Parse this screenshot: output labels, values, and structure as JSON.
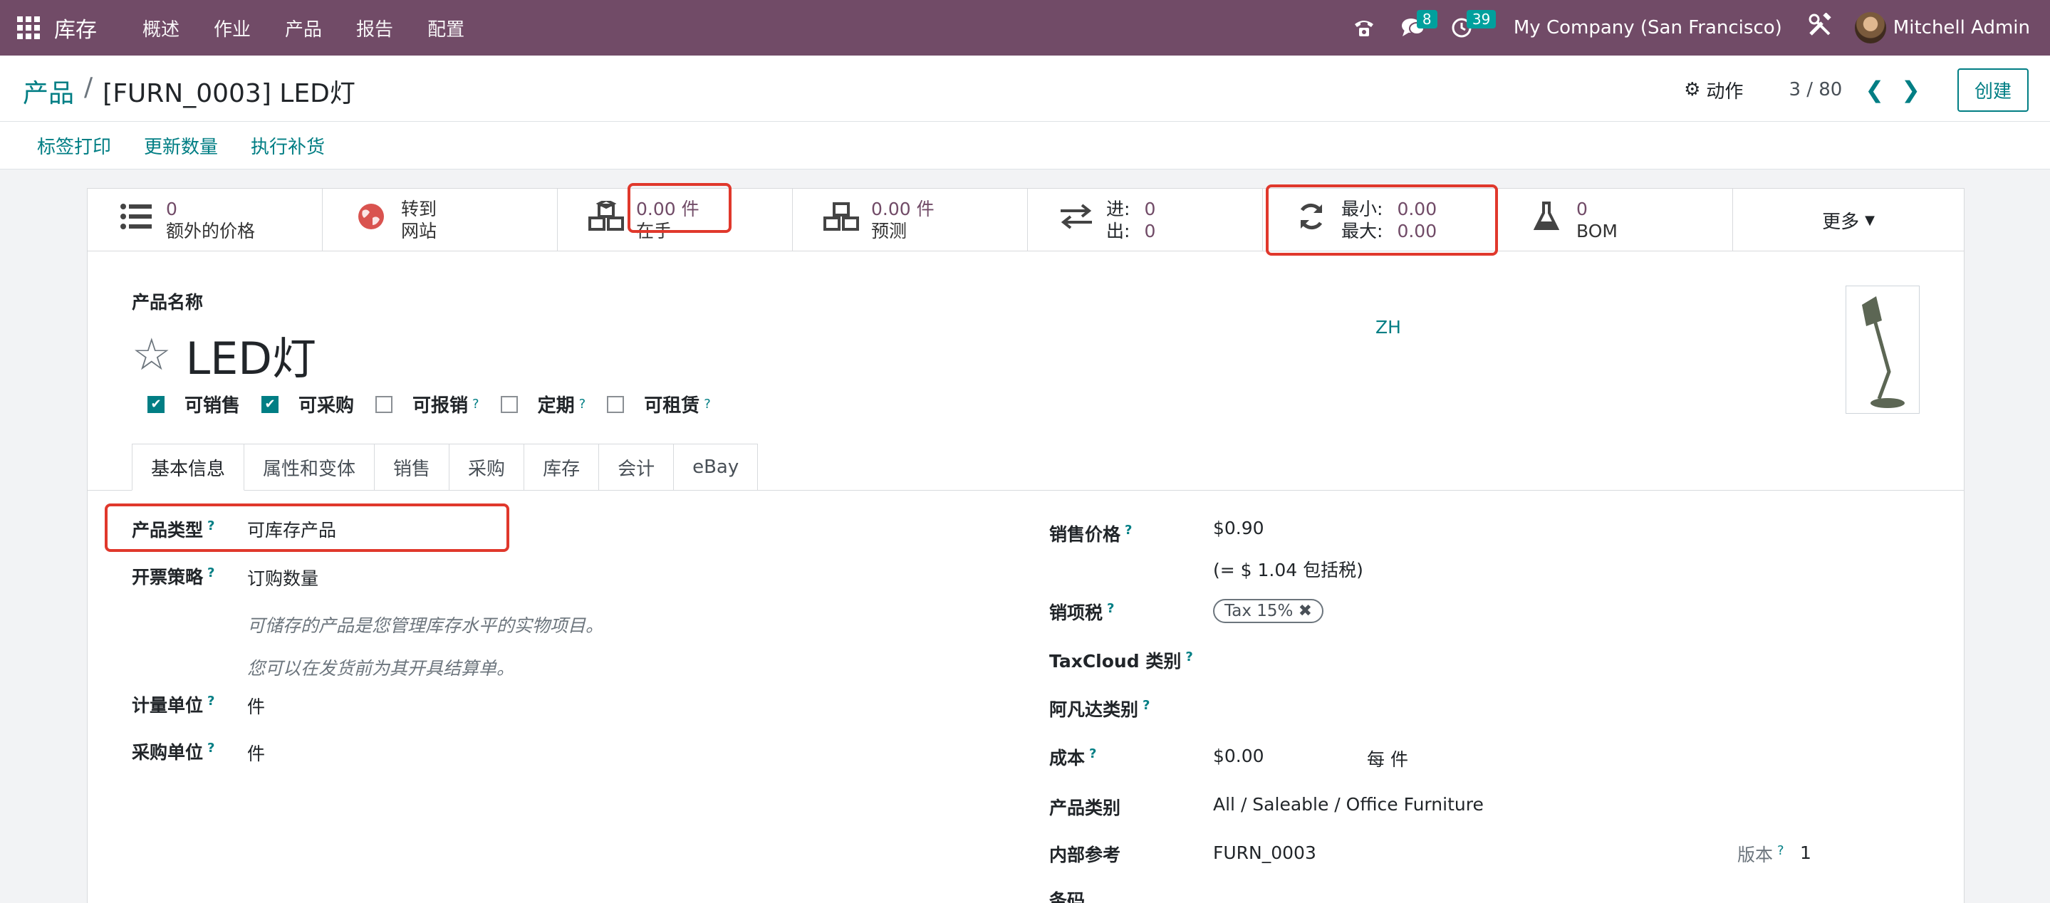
{
  "navbar": {
    "app_name": "库存",
    "menu": [
      "概述",
      "作业",
      "产品",
      "报告",
      "配置"
    ],
    "messages_count": "8",
    "activities_count": "39",
    "company": "My Company (San Francisco)",
    "user": "Mitchell Admin",
    "icons": {
      "apps": "apps-grid-icon",
      "phone": "phone-icon",
      "chat": "chat-icon",
      "clock": "clock-icon",
      "tools": "tools-icon"
    }
  },
  "control": {
    "breadcrumb_parent": "产品",
    "breadcrumb_sep": "/",
    "breadcrumb_current": "[FURN_0003] LED灯",
    "action_label": "动作",
    "pager": "3 / 80",
    "create_label": "创建",
    "buttons": [
      "标签打印",
      "更新数量",
      "执行补货"
    ]
  },
  "stats": {
    "extra_prices": {
      "value": "0",
      "label": "额外的价格"
    },
    "website": {
      "value": "转到",
      "label": "网站"
    },
    "on_hand": {
      "value": "0.00 件",
      "label": "在手"
    },
    "forecast": {
      "value": "0.00 件",
      "label": "预测"
    },
    "inout": {
      "in_label": "进:",
      "in_value": "0",
      "out_label": "出:",
      "out_value": "0"
    },
    "minmax": {
      "min_label": "最小:",
      "min_value": "0.00",
      "max_label": "最大:",
      "max_value": "0.00"
    },
    "bom": {
      "value": "0",
      "label": "BOM"
    },
    "more_label": "更多"
  },
  "product": {
    "name_label": "产品名称",
    "name": "LED灯",
    "lang": "ZH",
    "checks": [
      {
        "label": "可销售",
        "checked": true,
        "help": false
      },
      {
        "label": "可采购",
        "checked": true,
        "help": false
      },
      {
        "label": "可报销",
        "checked": false,
        "help": true
      },
      {
        "label": "定期",
        "checked": false,
        "help": true
      },
      {
        "label": "可租赁",
        "checked": false,
        "help": true
      }
    ]
  },
  "tabs": [
    "基本信息",
    "属性和变体",
    "销售",
    "采购",
    "库存",
    "会计",
    "eBay"
  ],
  "left_fields": {
    "type_label": "产品类型",
    "type_value": "可库存产品",
    "invoice_label": "开票策略",
    "invoice_value": "订购数量",
    "hint1": "可储存的产品是您管理库存水平的实物项目。",
    "hint2": "您可以在发货前为其开具结算单。",
    "uom_label": "计量单位",
    "uom_value": "件",
    "purchase_uom_label": "采购单位",
    "purchase_uom_value": "件"
  },
  "right_fields": {
    "price_label": "销售价格",
    "price_value": "$0.90",
    "price_incl": "(= $ 1.04 包括税)",
    "tax_label": "销项税",
    "tax_tag": "Tax 15%",
    "taxcloud_label": "TaxCloud 类别",
    "avalara_label": "阿凡达类别",
    "cost_label": "成本",
    "cost_value": "$0.00",
    "cost_unit": "每 件",
    "category_label": "产品类别",
    "category_value": "All / Saleable / Office Furniture",
    "ref_label": "内部参考",
    "ref_value": "FURN_0003",
    "version_label": "版本",
    "version_value": "1",
    "barcode_label": "条码"
  },
  "question_mark": "?"
}
